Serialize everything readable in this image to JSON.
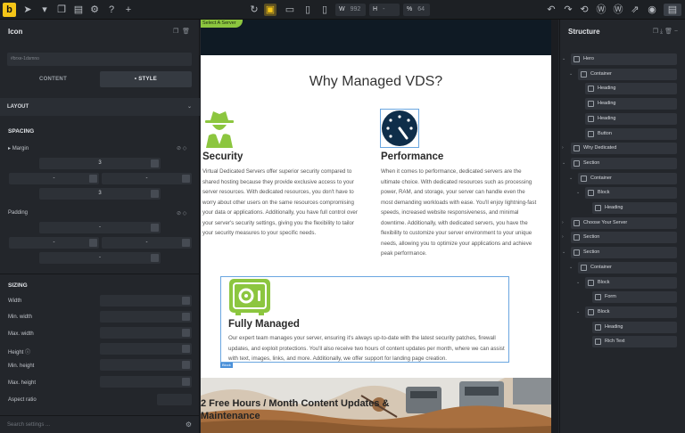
{
  "toolbar": {
    "width_label": "W",
    "width_value": "992",
    "height_label": "H",
    "height_value": "-",
    "scale_label": "%",
    "scale_value": "64"
  },
  "left_panel": {
    "title": "Icon",
    "class_placeholder": "#brxe-1dsmno",
    "tabs": [
      "CONTENT",
      "• STYLE"
    ],
    "layout_label": "LAYOUT",
    "spacing_label": "SPACING",
    "margin_label": "Margin",
    "margin_top": "3",
    "margin_right": "-",
    "margin_left": "-",
    "margin_bottom": "3",
    "padding_label": "Padding",
    "padding_placeholder": "-",
    "sizing_label": "SIZING",
    "sizing_fields": [
      "Width",
      "Min. width",
      "Max. width",
      "Height",
      "Min. height",
      "Max. height",
      "Aspect ratio"
    ],
    "search_placeholder": "Search settings ..."
  },
  "canvas": {
    "hero_button": "Select A Server",
    "heading": "Why Managed VDS?",
    "features": [
      {
        "title": "Security",
        "text": "Virtual Dedicated Servers offer superior security compared to shared hosting because they provide exclusive access to your server resources. With dedicated resources, you don't have to worry about other users on the same resources compromising your data or applications. Additionally, you have full control over your server's security settings, giving you the flexibility to tailor your security measures to your specific needs."
      },
      {
        "title": "Performance",
        "text": "When it comes to performance, dedicated servers are the ultimate choice. With dedicated resources such as processing power, RAM, and storage, your server can handle even the most demanding workloads with ease. You'll enjoy lightning-fast speeds, increased website responsiveness, and minimal downtime. Additionally, with dedicated servers, you have the flexibility to customize your server environment to your unique needs, allowing you to optimize your applications and achieve peak performance."
      },
      {
        "title": "Fully Managed",
        "text": "Our expert team manages your server, ensuring it's always up-to-date with the latest security patches, firewall updates, and exploit protections. You'll also receive two hours of content updates per month, where we can assist with text, images, links, and more. Additionally, we offer support for landing page creation."
      }
    ],
    "selected_tag": "Block",
    "banner_text": "2 Free Hours / Month Content Updates & Maintenance"
  },
  "structure": {
    "title": "Structure",
    "rows": [
      {
        "name": "Hero",
        "depth": 0,
        "arrow": "v"
      },
      {
        "name": "Container",
        "depth": 1,
        "arrow": "v"
      },
      {
        "name": "Heading",
        "depth": 2,
        "arrow": ""
      },
      {
        "name": "Heading",
        "depth": 2,
        "arrow": ""
      },
      {
        "name": "Heading",
        "depth": 2,
        "arrow": ""
      },
      {
        "name": "Button",
        "depth": 2,
        "arrow": ""
      },
      {
        "name": "Why Dedicated",
        "depth": 0,
        "arrow": ">"
      },
      {
        "name": "Section",
        "depth": 0,
        "arrow": "v"
      },
      {
        "name": "Container",
        "depth": 1,
        "arrow": "v"
      },
      {
        "name": "Block",
        "depth": 2,
        "arrow": "v"
      },
      {
        "name": "Heading",
        "depth": 3,
        "arrow": ""
      },
      {
        "name": "Choose Your Server",
        "depth": 0,
        "arrow": ">"
      },
      {
        "name": "Section",
        "depth": 0,
        "arrow": ">"
      },
      {
        "name": "Section",
        "depth": 0,
        "arrow": "v"
      },
      {
        "name": "Container",
        "depth": 1,
        "arrow": "v"
      },
      {
        "name": "Block",
        "depth": 2,
        "arrow": "v"
      },
      {
        "name": "Form",
        "depth": 3,
        "arrow": ""
      },
      {
        "name": "Block",
        "depth": 2,
        "arrow": "v"
      },
      {
        "name": "Heading",
        "depth": 3,
        "arrow": ""
      },
      {
        "name": "Rich Text",
        "depth": 3,
        "arrow": ""
      }
    ]
  },
  "colors": {
    "accent": "#f5c518",
    "brand_green": "#8cc63f",
    "dark_navy": "#0f2e4a",
    "selection_blue": "#4a90d9"
  }
}
